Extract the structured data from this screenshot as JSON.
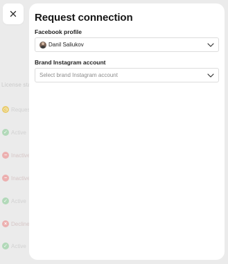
{
  "background": {
    "column_header": "License stat",
    "rows": [
      {
        "status": "pending",
        "label": "Request",
        "dot_color": "#e9cc6c",
        "label_color": "#d2d2d2",
        "icon": "clock-icon"
      },
      {
        "status": "active",
        "label": "Active",
        "dot_color": "#b2d9b9",
        "label_color": "#d2d2d2",
        "icon": "check-icon"
      },
      {
        "status": "inactive",
        "label": "Inactive",
        "dot_color": "#ecb0b0",
        "label_color": "#d6c6c6",
        "icon": "minus-icon"
      },
      {
        "status": "inactive",
        "label": "Inactive",
        "dot_color": "#ecb0b0",
        "label_color": "#d6c6c6",
        "icon": "minus-icon"
      },
      {
        "status": "active",
        "label": "Active",
        "dot_color": "#b2d9b9",
        "label_color": "#d2d2d2",
        "icon": "check-icon"
      },
      {
        "status": "declined",
        "label": "Declined",
        "dot_color": "#ecb0b0",
        "label_color": "#d6c6c6",
        "icon": "x-icon"
      },
      {
        "status": "active",
        "label": "Active",
        "dot_color": "#b2d9b9",
        "label_color": "#d2d2d2",
        "icon": "check-icon"
      }
    ]
  },
  "close_button": {
    "icon": "close-icon"
  },
  "modal": {
    "title": "Request connection",
    "facebook_profile": {
      "label": "Facebook profile",
      "value": "Danil Saliukov",
      "avatar": "user-avatar",
      "icon": "chevron-down-icon"
    },
    "instagram_account": {
      "label": "Brand Instagram account",
      "placeholder": "Select brand Instagram account",
      "icon": "chevron-down-icon"
    }
  },
  "colors": {
    "panel": "#ffffff",
    "backdrop": "#ebebeb",
    "border": "#dcdcdc",
    "title": "#161616"
  }
}
